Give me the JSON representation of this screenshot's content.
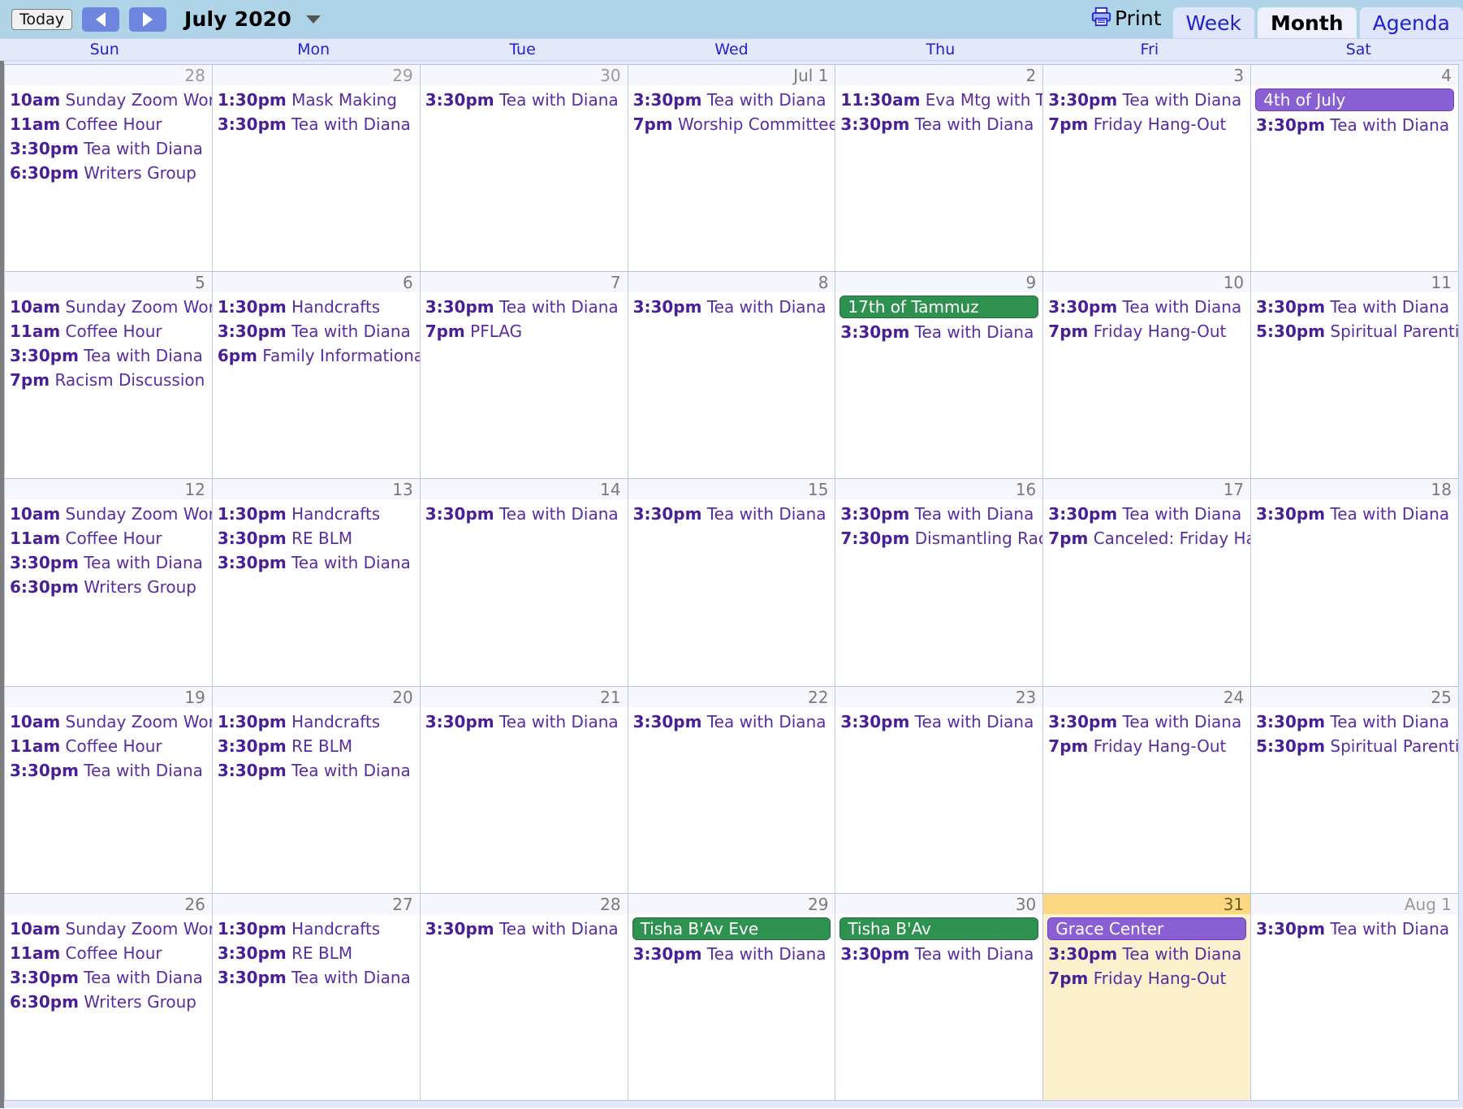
{
  "toolbar": {
    "today_label": "Today",
    "prev_label": "Previous period",
    "next_label": "Next period",
    "month_label": "July 2020",
    "dropdown_label": "chevron-down",
    "print_label": "Print",
    "tabs": [
      {
        "label": "Week",
        "active": false
      },
      {
        "label": "Month",
        "active": true
      },
      {
        "label": "Agenda",
        "active": false
      }
    ]
  },
  "colors": {
    "toolbar_bg": "#afd4e8",
    "header_bg": "#e4e8fb",
    "event_text": "#5a2ca0",
    "chip_purple": "#8a5fd4",
    "chip_green": "#2f9150",
    "today_bg": "#fdd882",
    "today_events_bg": "#fdf0cd"
  },
  "day_names": [
    "Sun",
    "Mon",
    "Tue",
    "Wed",
    "Thu",
    "Fri",
    "Sat"
  ],
  "weeks": [
    [
      {
        "daynum": "28",
        "other": true,
        "today": false,
        "chips": [],
        "events": [
          {
            "time": "10am",
            "title": "Sunday Zoom Wors"
          },
          {
            "time": "11am",
            "title": "Coffee Hour"
          },
          {
            "time": "3:30pm",
            "title": "Tea with Diana"
          },
          {
            "time": "6:30pm",
            "title": "Writers Group"
          }
        ]
      },
      {
        "daynum": "29",
        "other": true,
        "today": false,
        "chips": [],
        "events": [
          {
            "time": "1:30pm",
            "title": "Mask Making"
          },
          {
            "time": "3:30pm",
            "title": "Tea with Diana"
          }
        ]
      },
      {
        "daynum": "30",
        "other": true,
        "today": false,
        "chips": [],
        "events": [
          {
            "time": "3:30pm",
            "title": "Tea with Diana"
          }
        ]
      },
      {
        "daynum": "Jul 1",
        "other": false,
        "today": false,
        "chips": [],
        "events": [
          {
            "time": "3:30pm",
            "title": "Tea with Diana"
          },
          {
            "time": "7pm",
            "title": "Worship Committee"
          }
        ]
      },
      {
        "daynum": "2",
        "other": false,
        "today": false,
        "chips": [],
        "events": [
          {
            "time": "11:30am",
            "title": "Eva Mtg with Tori"
          },
          {
            "time": "3:30pm",
            "title": "Tea with Diana"
          }
        ]
      },
      {
        "daynum": "3",
        "other": false,
        "today": false,
        "chips": [],
        "events": [
          {
            "time": "3:30pm",
            "title": "Tea with Diana"
          },
          {
            "time": "7pm",
            "title": "Friday Hang-Out"
          }
        ]
      },
      {
        "daynum": "4",
        "other": false,
        "today": false,
        "chips": [
          {
            "label": "4th of July",
            "color": "purple"
          }
        ],
        "events": [
          {
            "time": "3:30pm",
            "title": "Tea with Diana"
          }
        ]
      }
    ],
    [
      {
        "daynum": "5",
        "other": false,
        "today": false,
        "chips": [],
        "events": [
          {
            "time": "10am",
            "title": "Sunday Zoom Wors"
          },
          {
            "time": "11am",
            "title": "Coffee Hour"
          },
          {
            "time": "3:30pm",
            "title": "Tea with Diana"
          },
          {
            "time": "7pm",
            "title": "Racism Discussion"
          }
        ]
      },
      {
        "daynum": "6",
        "other": false,
        "today": false,
        "chips": [],
        "events": [
          {
            "time": "1:30pm",
            "title": "Handcrafts"
          },
          {
            "time": "3:30pm",
            "title": "Tea with Diana"
          },
          {
            "time": "6pm",
            "title": "Family Informationa"
          }
        ]
      },
      {
        "daynum": "7",
        "other": false,
        "today": false,
        "chips": [],
        "events": [
          {
            "time": "3:30pm",
            "title": "Tea with Diana"
          },
          {
            "time": "7pm",
            "title": "PFLAG"
          }
        ]
      },
      {
        "daynum": "8",
        "other": false,
        "today": false,
        "chips": [],
        "events": [
          {
            "time": "3:30pm",
            "title": "Tea with Diana"
          }
        ]
      },
      {
        "daynum": "9",
        "other": false,
        "today": false,
        "chips": [
          {
            "label": "17th of Tammuz",
            "color": "green"
          }
        ],
        "events": [
          {
            "time": "3:30pm",
            "title": "Tea with Diana"
          }
        ]
      },
      {
        "daynum": "10",
        "other": false,
        "today": false,
        "chips": [],
        "events": [
          {
            "time": "3:30pm",
            "title": "Tea with Diana"
          },
          {
            "time": "7pm",
            "title": "Friday Hang-Out"
          }
        ]
      },
      {
        "daynum": "11",
        "other": false,
        "today": false,
        "chips": [],
        "events": [
          {
            "time": "3:30pm",
            "title": "Tea with Diana"
          },
          {
            "time": "5:30pm",
            "title": "Spiritual Parenting"
          }
        ]
      }
    ],
    [
      {
        "daynum": "12",
        "other": false,
        "today": false,
        "chips": [],
        "events": [
          {
            "time": "10am",
            "title": "Sunday Zoom Wors"
          },
          {
            "time": "11am",
            "title": "Coffee Hour"
          },
          {
            "time": "3:30pm",
            "title": "Tea with Diana"
          },
          {
            "time": "6:30pm",
            "title": "Writers Group"
          }
        ]
      },
      {
        "daynum": "13",
        "other": false,
        "today": false,
        "chips": [],
        "events": [
          {
            "time": "1:30pm",
            "title": "Handcrafts"
          },
          {
            "time": "3:30pm",
            "title": "RE BLM"
          },
          {
            "time": "3:30pm",
            "title": "Tea with Diana"
          }
        ]
      },
      {
        "daynum": "14",
        "other": false,
        "today": false,
        "chips": [],
        "events": [
          {
            "time": "3:30pm",
            "title": "Tea with Diana"
          }
        ]
      },
      {
        "daynum": "15",
        "other": false,
        "today": false,
        "chips": [],
        "events": [
          {
            "time": "3:30pm",
            "title": "Tea with Diana"
          }
        ]
      },
      {
        "daynum": "16",
        "other": false,
        "today": false,
        "chips": [],
        "events": [
          {
            "time": "3:30pm",
            "title": "Tea with Diana"
          },
          {
            "time": "7:30pm",
            "title": "Dismantling Racis"
          }
        ]
      },
      {
        "daynum": "17",
        "other": false,
        "today": false,
        "chips": [],
        "events": [
          {
            "time": "3:30pm",
            "title": "Tea with Diana"
          },
          {
            "time": "7pm",
            "title": "Canceled: Friday Ha"
          }
        ]
      },
      {
        "daynum": "18",
        "other": false,
        "today": false,
        "chips": [],
        "events": [
          {
            "time": "3:30pm",
            "title": "Tea with Diana"
          }
        ]
      }
    ],
    [
      {
        "daynum": "19",
        "other": false,
        "today": false,
        "chips": [],
        "events": [
          {
            "time": "10am",
            "title": "Sunday Zoom Wors"
          },
          {
            "time": "11am",
            "title": "Coffee Hour"
          },
          {
            "time": "3:30pm",
            "title": "Tea with Diana"
          }
        ]
      },
      {
        "daynum": "20",
        "other": false,
        "today": false,
        "chips": [],
        "events": [
          {
            "time": "1:30pm",
            "title": "Handcrafts"
          },
          {
            "time": "3:30pm",
            "title": "RE BLM"
          },
          {
            "time": "3:30pm",
            "title": "Tea with Diana"
          }
        ]
      },
      {
        "daynum": "21",
        "other": false,
        "today": false,
        "chips": [],
        "events": [
          {
            "time": "3:30pm",
            "title": "Tea with Diana"
          }
        ]
      },
      {
        "daynum": "22",
        "other": false,
        "today": false,
        "chips": [],
        "events": [
          {
            "time": "3:30pm",
            "title": "Tea with Diana"
          }
        ]
      },
      {
        "daynum": "23",
        "other": false,
        "today": false,
        "chips": [],
        "events": [
          {
            "time": "3:30pm",
            "title": "Tea with Diana"
          }
        ]
      },
      {
        "daynum": "24",
        "other": false,
        "today": false,
        "chips": [],
        "events": [
          {
            "time": "3:30pm",
            "title": "Tea with Diana"
          },
          {
            "time": "7pm",
            "title": "Friday Hang-Out"
          }
        ]
      },
      {
        "daynum": "25",
        "other": false,
        "today": false,
        "chips": [],
        "events": [
          {
            "time": "3:30pm",
            "title": "Tea with Diana"
          },
          {
            "time": "5:30pm",
            "title": "Spiritual Parenting"
          }
        ]
      }
    ],
    [
      {
        "daynum": "26",
        "other": false,
        "today": false,
        "chips": [],
        "events": [
          {
            "time": "10am",
            "title": "Sunday Zoom Wors"
          },
          {
            "time": "11am",
            "title": "Coffee Hour"
          },
          {
            "time": "3:30pm",
            "title": "Tea with Diana"
          },
          {
            "time": "6:30pm",
            "title": "Writers Group"
          }
        ]
      },
      {
        "daynum": "27",
        "other": false,
        "today": false,
        "chips": [],
        "events": [
          {
            "time": "1:30pm",
            "title": "Handcrafts"
          },
          {
            "time": "3:30pm",
            "title": "RE BLM"
          },
          {
            "time": "3:30pm",
            "title": "Tea with Diana"
          }
        ]
      },
      {
        "daynum": "28",
        "other": false,
        "today": false,
        "chips": [],
        "events": [
          {
            "time": "3:30pm",
            "title": "Tea with Diana"
          }
        ]
      },
      {
        "daynum": "29",
        "other": false,
        "today": false,
        "chips": [
          {
            "label": "Tisha B'Av Eve",
            "color": "green"
          }
        ],
        "events": [
          {
            "time": "3:30pm",
            "title": "Tea with Diana"
          }
        ]
      },
      {
        "daynum": "30",
        "other": false,
        "today": false,
        "chips": [
          {
            "label": "Tisha B'Av",
            "color": "green"
          }
        ],
        "events": [
          {
            "time": "3:30pm",
            "title": "Tea with Diana"
          }
        ]
      },
      {
        "daynum": "31",
        "other": false,
        "today": true,
        "chips": [
          {
            "label": "Grace Center",
            "color": "purple"
          }
        ],
        "events": [
          {
            "time": "3:30pm",
            "title": "Tea with Diana"
          },
          {
            "time": "7pm",
            "title": "Friday Hang-Out"
          }
        ]
      },
      {
        "daynum": "Aug 1",
        "other": true,
        "today": false,
        "chips": [],
        "events": [
          {
            "time": "3:30pm",
            "title": "Tea with Diana"
          }
        ]
      }
    ]
  ]
}
